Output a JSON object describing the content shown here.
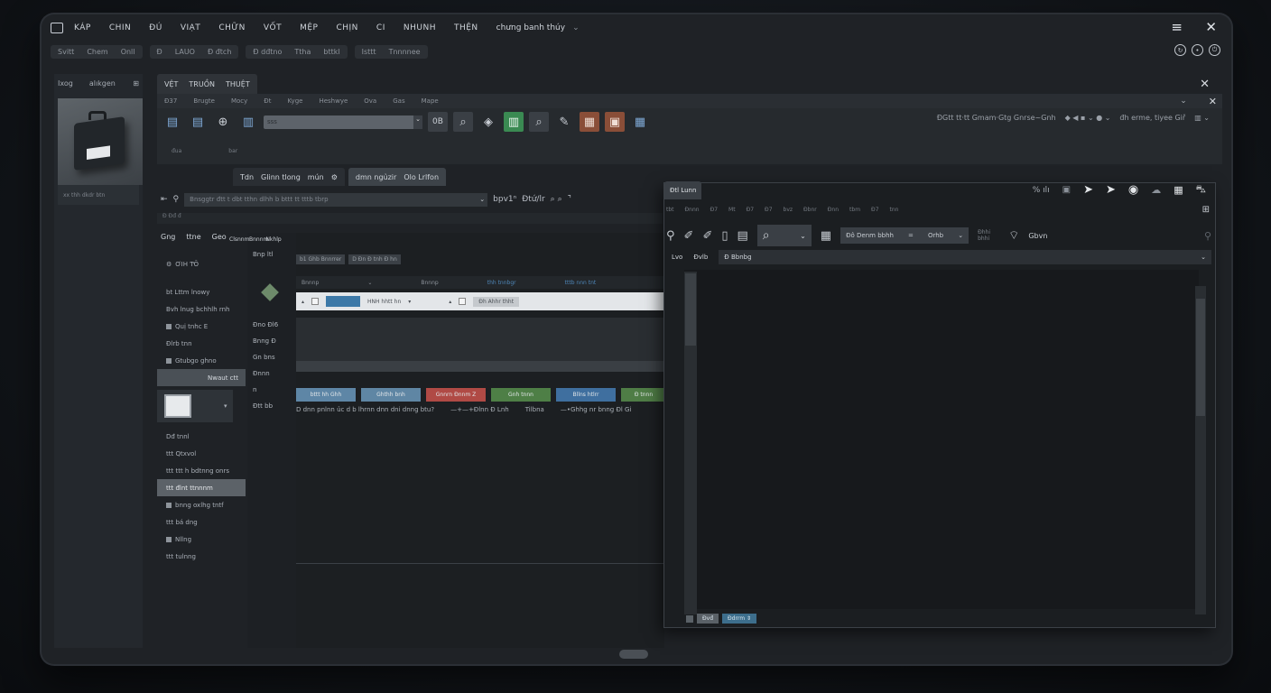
{
  "menubar": {
    "items": [
      "KÁP",
      "CHIN",
      "ĐÚ",
      "VIẠT",
      "CHỮN",
      "VỐT",
      "MỆP",
      "CHỊN",
      "CI",
      "NHUNH",
      "THỆN",
      "chưng banh thúy"
    ]
  },
  "subtabs": [
    {
      "labels": [
        "Svitt",
        "Chem",
        "Onll"
      ]
    },
    {
      "labels": [
        "Đ",
        "LAUO",
        "Đ đtch"
      ]
    },
    {
      "labels": [
        "Đ dđtno",
        "Ttha",
        "bttkl"
      ]
    },
    {
      "labels": [
        "Isttt",
        "Tnnnnee"
      ]
    }
  ],
  "left_panel": {
    "header": [
      "Ixog",
      "alıkgen",
      "⊞"
    ],
    "caption": "xx thh dkdr btn"
  },
  "doc_tabs": [
    "VỆT",
    "TRUỒN",
    "THUỆT"
  ],
  "ribbon_labels": [
    "Đ37",
    "Brugte",
    "Mocy",
    "Đt",
    "Kyge",
    "Heshwye",
    "Ova",
    "Gas",
    "Mape"
  ],
  "toolbar": {
    "select_value": "sss",
    "right_text": "ĐGtt  tt·tt Gmam·Gtg Gnrse~Gnh",
    "right_text2": "đh  erme, tiyee Giř",
    "sub_labels": [
      "đua",
      "bar"
    ]
  },
  "tabs2": [
    {
      "label": "Tdn",
      "extra": "Glinn tlong",
      "end": "mún",
      "active": false
    },
    {
      "label": "dmn ngủzir",
      "extra": "Olo Lrlfon",
      "end": "",
      "active": true
    }
  ],
  "addressbar": {
    "value": "Bnsggtr đtt t dbt tthn dlhh b bttt tt tttb tbrp",
    "extra": "bpv1ⁿ",
    "zoom": "Đtứ/lr"
  },
  "crumb": "Đ   Đđ   đ",
  "file_tree": {
    "head": [
      "Gng",
      "ttne",
      "Geo"
    ],
    "title": "ƠIH Ƭ̛Ŏ",
    "items": [
      {
        "label": "bt Lttm lnowy",
        "type": "plain"
      },
      {
        "label": "Bvh lnug bchhlh rnh",
        "type": "plain"
      },
      {
        "label": "Quị tnhc E",
        "type": "check"
      },
      {
        "label": "Đlrb tnn",
        "type": "plain"
      },
      {
        "label": "Gtubgo ghno",
        "type": "check"
      },
      {
        "label": "Nwaut ctt",
        "type": "hl"
      },
      {
        "label": "Dđ tnnl",
        "type": "plain"
      },
      {
        "label": "ttt Qtxvol",
        "type": "plain"
      },
      {
        "label": "ttt ttt h bdtnng onrs",
        "type": "plain"
      },
      {
        "label": "ttt đlnt ttnnnm",
        "type": "sel"
      },
      {
        "label": "bnng oxlhg tntf",
        "type": "check"
      },
      {
        "label": "ttt bá dng",
        "type": "plain"
      },
      {
        "label": "Nllng",
        "type": "check"
      },
      {
        "label": "ttt tulnng",
        "type": "plain"
      }
    ]
  },
  "center_col": {
    "head": [
      "Bnnnm",
      "Clsnnm",
      "Nkhlp"
    ],
    "top": "Bnp ltl",
    "items": [
      "Đno Đl6",
      "Bnng Đ",
      "Gn bns",
      "Đnnn",
      "n",
      "Đtt bb"
    ]
  },
  "grid": {
    "tags": [
      "b1 Ghb Bnnrrer",
      "D Đn Đ tnh Đ hn"
    ],
    "head": [
      "Bnnnp",
      "Bnnnp",
      "thh tnnbgr",
      "tttb nnn tnt"
    ],
    "row_text": "HNH hhtt hn",
    "row_chip": "Đh",
    "row_chip2": "Ahhr thht",
    "buttons": [
      "bttt hh Ghh",
      "Ghthh bnh",
      "Gnnrn Đnnm  Z",
      "Gnh tnnn",
      "Bllns htlrr",
      "Đ tnnn"
    ],
    "caption": [
      "D dnn pnlnn ủc  d b  lhrnn dnn dni dnng  btu?",
      "—+—+Đlnn Đ Lnh",
      "Tilbna",
      "—•Ghhg nr bnng Đl Gi"
    ]
  },
  "float_window": {
    "title": "Đtl Lunn",
    "menu": [
      "tbt",
      "Đnnn",
      "Đ7",
      "Mt",
      "Đ7",
      "Đ7",
      "bvz",
      "Đbnr",
      "Đnn",
      "tbm",
      "Đ7",
      "tnn"
    ],
    "select_value": "Đô Denm bbhh",
    "select_sep": "=",
    "select_extra": "Orhb",
    "toolbar_text": "Gbvn",
    "toolbar_small": "Đhhi bhhi",
    "addr": [
      "Lvo",
      "Đvlb",
      "Đ Bbnbg"
    ],
    "status": [
      "Đvđ",
      "Đdrrm ⇕"
    ]
  }
}
